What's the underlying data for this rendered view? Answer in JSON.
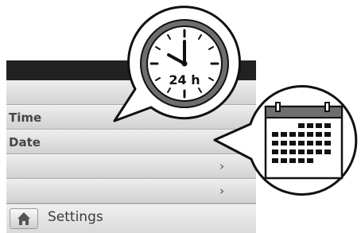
{
  "menu": {
    "items": [
      {
        "label": "",
        "has_arrow": false
      },
      {
        "label": "Time",
        "has_arrow": false
      },
      {
        "label": "Date",
        "has_arrow": false
      },
      {
        "label": "",
        "has_arrow": true
      },
      {
        "label": "",
        "has_arrow": true
      }
    ],
    "arrow_glyph": "›"
  },
  "bottom_bar": {
    "home_icon": "home-icon",
    "label": "Settings"
  },
  "callouts": {
    "clock": {
      "icon": "clock-icon",
      "format_label": "24 h"
    },
    "calendar": {
      "icon": "calendar-icon"
    }
  },
  "colors": {
    "title_bar": "#222222",
    "row_light": "#ececec",
    "row_dark": "#d2d2d2",
    "text": "#454545"
  }
}
